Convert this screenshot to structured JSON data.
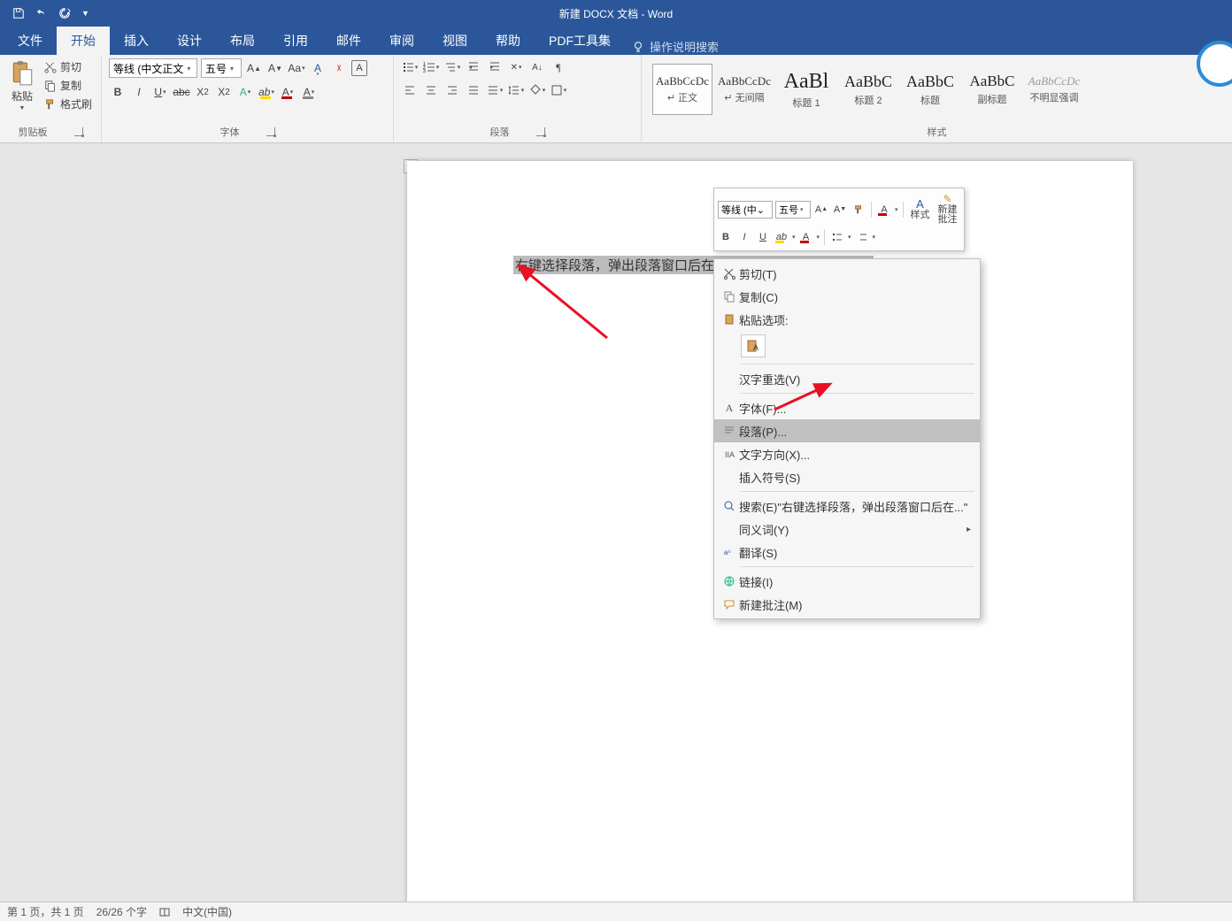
{
  "title": "新建 DOCX 文档 - Word",
  "ribbon_tabs": {
    "file": "文件",
    "home": "开始",
    "insert": "插入",
    "design": "设计",
    "layout": "布局",
    "references": "引用",
    "mailings": "邮件",
    "review": "审阅",
    "view": "视图",
    "help": "帮助",
    "pdf": "PDF工具集",
    "tellme": "操作说明搜索"
  },
  "clipboard": {
    "paste": "粘贴",
    "cut": "剪切",
    "copy": "复制",
    "format_painter": "格式刷",
    "group": "剪贴板"
  },
  "font": {
    "name": "等线 (中文正文",
    "size": "五号",
    "group": "字体"
  },
  "paragraph": {
    "group": "段落"
  },
  "styles": {
    "group": "样式",
    "list": [
      {
        "prev": "AaBbCcDc",
        "name": "正文",
        "sel": true,
        "psz": "13px",
        "pcolor": "#333",
        "prefix": "↵ "
      },
      {
        "prev": "AaBbCcDc",
        "name": "无间隔",
        "sel": false,
        "psz": "13px",
        "pcolor": "#333",
        "prefix": "↵ "
      },
      {
        "prev": "AaBl",
        "name": "标题 1",
        "sel": false,
        "psz": "24px",
        "pcolor": "#222",
        "prefix": ""
      },
      {
        "prev": "AaBbC",
        "name": "标题 2",
        "sel": false,
        "psz": "18px",
        "pcolor": "#222",
        "prefix": ""
      },
      {
        "prev": "AaBbC",
        "name": "标题",
        "sel": false,
        "psz": "18px",
        "pcolor": "#222",
        "prefix": ""
      },
      {
        "prev": "AaBbC",
        "name": "副标题",
        "sel": false,
        "psz": "17px",
        "pcolor": "#222",
        "prefix": ""
      },
      {
        "prev": "AaBbCcDc",
        "name": "不明显强调",
        "sel": false,
        "psz": "13px",
        "pcolor": "#999",
        "prefix": "",
        "italic": true
      }
    ]
  },
  "document_text": "右键选择段落，弹出段落窗口后在行距中选择一个行距样式↵",
  "mini": {
    "font": "等线 (中⌄",
    "size": "五号",
    "styles": "样式",
    "comment": "新建\n批注"
  },
  "context_menu": {
    "cut": "剪切(T)",
    "copy": "复制(C)",
    "paste_options": "粘贴选项:",
    "ime": "汉字重选(V)",
    "font": "字体(F)...",
    "paragraph": "段落(P)...",
    "text_direction": "文字方向(X)...",
    "insert_symbol": "插入符号(S)",
    "search": "搜索(E)\"右键选择段落，弹出段落窗口后在...\"",
    "synonyms": "同义词(Y)",
    "translate": "翻译(S)",
    "link": "链接(I)",
    "new_comment": "新建批注(M)"
  },
  "status": {
    "page": "第 1 页，共 1 页",
    "words": "26/26 个字",
    "lang": "中文(中国)"
  }
}
